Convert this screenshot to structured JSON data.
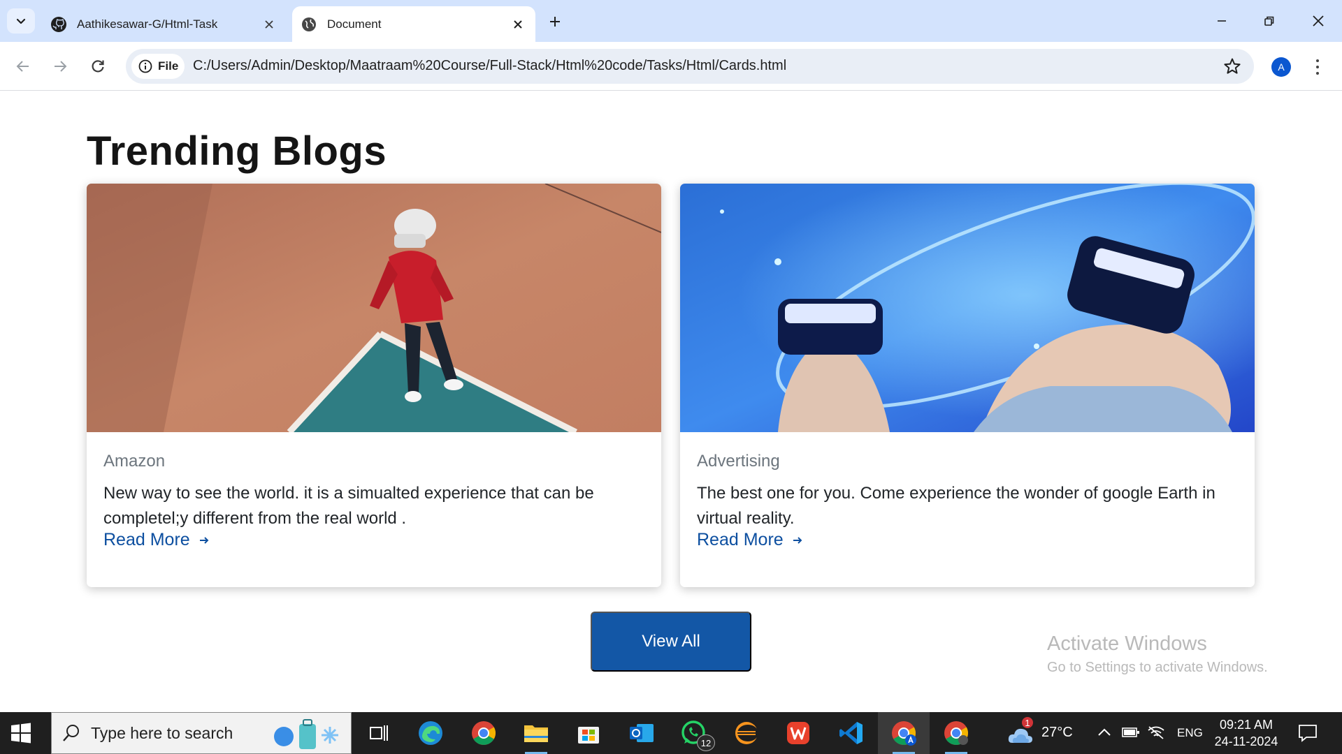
{
  "browser": {
    "tabs": [
      {
        "title": "Aathikesawar-G/Html-Task",
        "icon": "github-icon",
        "active": false
      },
      {
        "title": "Document",
        "icon": "globe-icon",
        "active": true
      }
    ],
    "address_chip": "File",
    "url": "C:/Users/Admin/Desktop/Maatraam%20Course/Full-Stack/Html%20code/Tasks/Html/Cards.html",
    "profile_initial": "A"
  },
  "page": {
    "title": "Trending Blogs",
    "cards": [
      {
        "category": "Amazon",
        "text": "New way to see the world. it is a simualted experience that can be completel;y different from the real world .",
        "link": "Read More",
        "image": "person-in-vr-headset-on-court-photo"
      },
      {
        "category": "Advertising",
        "text": "The best one for you. Come experience the wonder of google Earth in virtual reality.",
        "link": "Read More",
        "image": "two-people-in-vr-headsets-blue-photo"
      }
    ],
    "view_all": "View All"
  },
  "watermark": {
    "line1": "Activate Windows",
    "line2": "Go to Settings to activate Windows."
  },
  "taskbar": {
    "search_placeholder": "Type here to search",
    "whatsapp_badge": "12",
    "weather_badge": "1",
    "temperature": "27°C",
    "language": "ENG",
    "time": "09:21 AM",
    "date": "24-11-2024"
  },
  "colors": {
    "tabstrip": "#d3e3fd",
    "accent_link": "#0d4fa0",
    "button": "#1357a6",
    "taskbar": "#1f1f1f"
  }
}
